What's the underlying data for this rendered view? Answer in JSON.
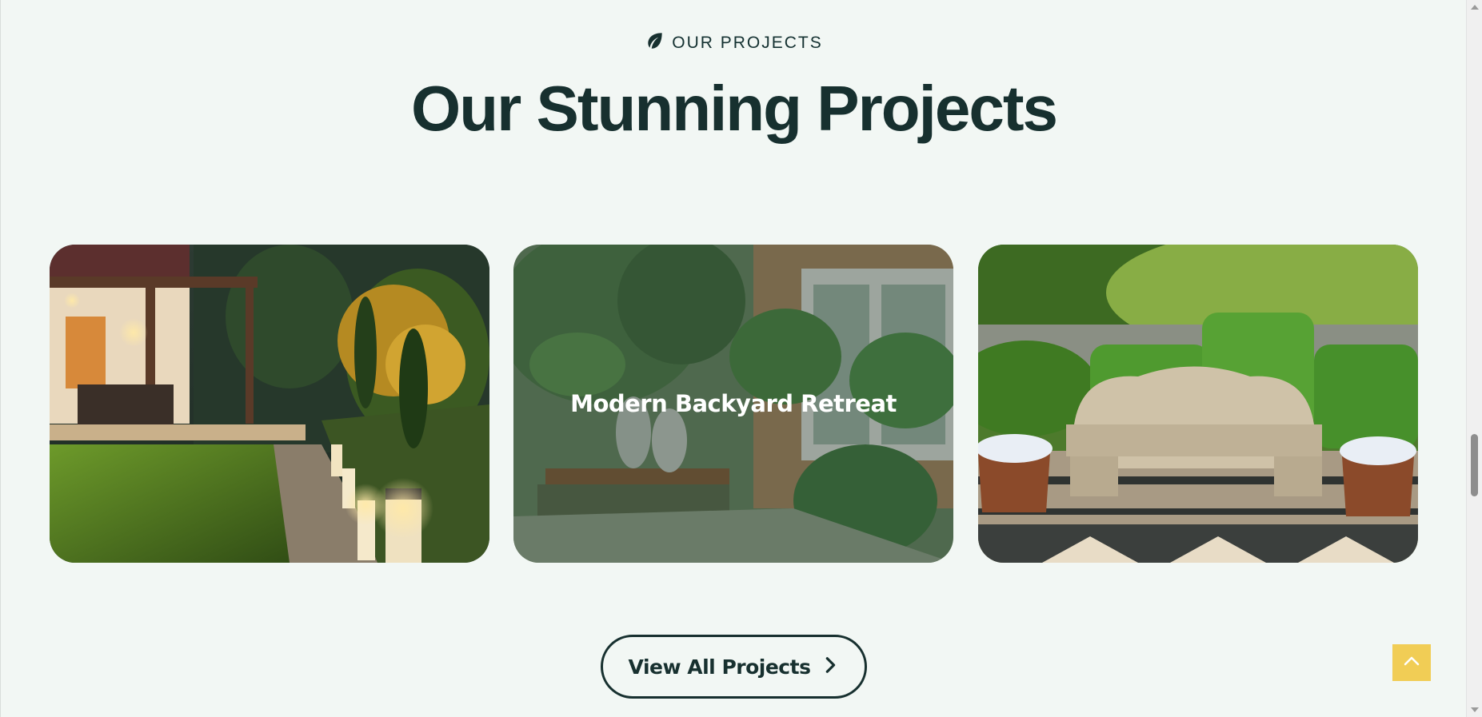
{
  "section": {
    "eyebrow": "OUR PROJECTS",
    "eyebrow_icon": "leaf-icon",
    "heading": "Our Stunning Projects"
  },
  "projects": [
    {
      "image": "garden-lighting-patio-photo",
      "title": ""
    },
    {
      "image": "tropical-backyard-photo",
      "title": "Modern Backyard Retreat"
    },
    {
      "image": "stone-bench-garden-photo",
      "title": ""
    }
  ],
  "cta": {
    "label": "View All Projects",
    "icon": "chevron-right-icon"
  },
  "back_to_top": {
    "icon": "chevron-up-icon"
  },
  "colors": {
    "background": "#f2f7f4",
    "text": "#17302f",
    "accent": "#f1cd55"
  }
}
